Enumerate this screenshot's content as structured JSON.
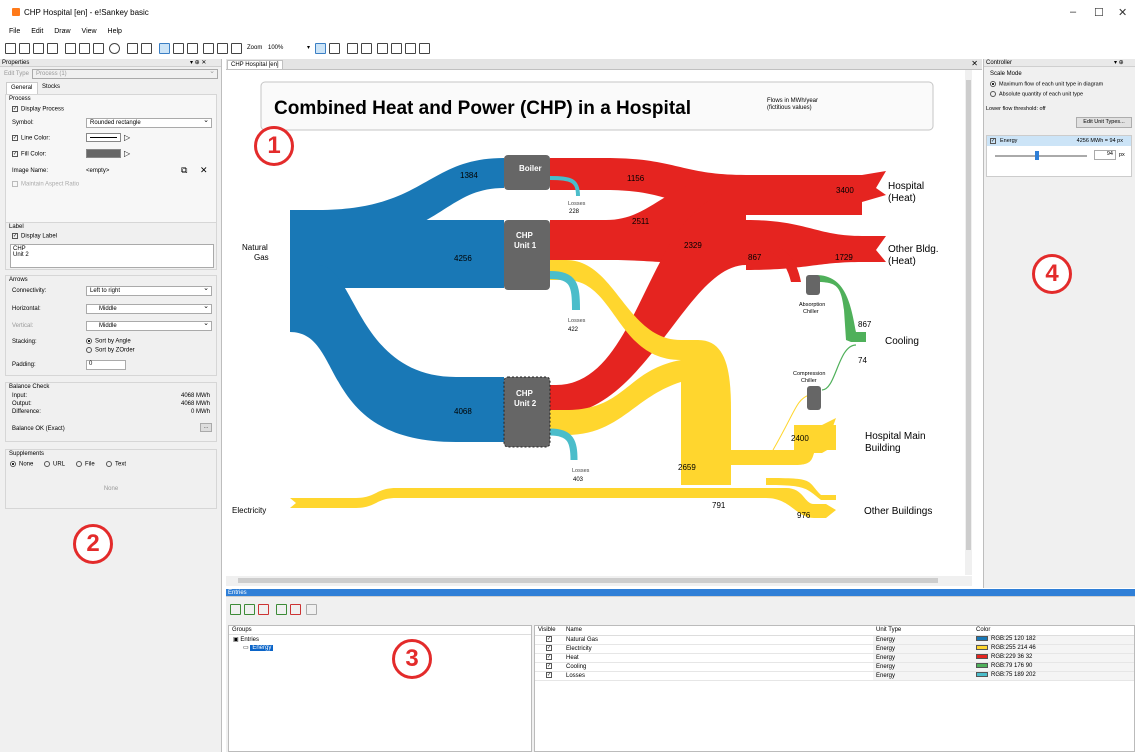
{
  "window": {
    "title": "CHP Hospital [en] - e!Sankey basic"
  },
  "menu": [
    "File",
    "Edit",
    "Draw",
    "View",
    "Help"
  ],
  "toolbar": {
    "zoom_label": "Zoom",
    "zoom_value": "100%"
  },
  "properties": {
    "panel_title": "Properties",
    "edit_type_label": "Edit Type",
    "edit_type_value": "Process (1)",
    "tabs": [
      "General",
      "Stocks"
    ],
    "process": {
      "header": "Process",
      "display_process": "Display Process",
      "symbol_label": "Symbol:",
      "symbol_value": "Rounded rectangle",
      "line_color_label": "Line Color:",
      "fill_color_label": "Fill Color:",
      "image_name_label": "Image Name:",
      "image_name_value": "<empty>",
      "maintain_aspect": "Maintain Aspect Ratio"
    },
    "label": {
      "header": "Label",
      "display_label": "Display Label",
      "line1": "CHP",
      "line2": "Unit 2"
    },
    "arrows": {
      "header": "Arrows",
      "connectivity_label": "Connectivity:",
      "connectivity_value": "Left to right",
      "horizontal_label": "Horizontal:",
      "horizontal_value": "Middle",
      "vertical_label": "Vertical:",
      "vertical_value": "Middle",
      "stacking_label": "Stacking:",
      "stacking_opt1": "Sort by Angle",
      "stacking_opt2": "Sort by ZOrder",
      "padding_label": "Padding:",
      "padding_value": "0"
    },
    "balance": {
      "header": "Balance Check",
      "input_label": "Input:",
      "input_value": "4068 MWh",
      "output_label": "Output:",
      "output_value": "4068 MWh",
      "difference_label": "Difference:",
      "difference_value": "0 MWh",
      "status": "Balance OK (Exact)"
    },
    "supplements": {
      "header": "Supplements",
      "options": [
        "None",
        "URL",
        "File",
        "Text"
      ],
      "current": "None"
    }
  },
  "document_tab": "CHP Hospital [en]",
  "diagram": {
    "title": "Combined Heat and Power (CHP) in a Hospital",
    "note1": "Flows in MWh/year",
    "note2": "(fictitious values)",
    "nodes": {
      "natural_gas1": "Natural",
      "natural_gas2": "Gas",
      "electricity": "Electricity",
      "boiler": "Boiler",
      "chp1a": "CHP",
      "chp1b": "Unit 1",
      "chp2a": "CHP",
      "chp2b": "Unit 2",
      "absorption1": "Absorption",
      "absorption2": "Chiller",
      "compression1": "Compression",
      "compression2": "Chiller",
      "hospital_heat1": "Hospital",
      "hospital_heat2": "(Heat)",
      "other_heat1": "Other Bldg.",
      "other_heat2": "(Heat)",
      "cooling": "Cooling",
      "hospital_main1": "Hospital Main",
      "hospital_main2": "Building",
      "other_buildings": "Other Buildings",
      "losses": "Losses"
    },
    "values": {
      "gas_boiler": "1384",
      "gas_chp1": "4256",
      "gas_chp2": "4068",
      "boiler_heat": "1156",
      "boiler_loss": "228",
      "chp1_heat": "2511",
      "chp1_loss": "422",
      "chp2_heat": "2329",
      "chp2_loss": "403",
      "hospital_heat": "3400",
      "other_heat": "1729",
      "to_absorption": "867",
      "cooling_in": "867",
      "compression": "74",
      "elec_junction": "2659",
      "hospital_main": "2400",
      "elec_direct": "791",
      "other_buildings": "976"
    }
  },
  "callouts": [
    "1",
    "2",
    "3",
    "4"
  ],
  "controller": {
    "title": "Controller",
    "scale_mode": "Scale Mode",
    "opt1": "Maximum flow of each unit type in diagram",
    "opt2": "Absolute quantity of each unit type",
    "threshold": "Lower flow threshold: off",
    "edit_button": "Edit Unit Types...",
    "energy_label": "Energy",
    "energy_scale": "4256 MWh = 94 px",
    "px_value": "94",
    "px_unit": "px",
    "slider_fraction": 0.45
  },
  "entries": {
    "title": "Entries",
    "groups_header": "Groups",
    "tree_root": "Entries",
    "tree_child": "Energy",
    "columns": [
      "Visible",
      "Name",
      "Unit Type",
      "Color"
    ],
    "rows": [
      {
        "name": "Natural Gas",
        "unit": "Energy",
        "color": "RGB:25 120 182",
        "hex": "#1978b6"
      },
      {
        "name": "Electricity",
        "unit": "Energy",
        "color": "RGB:255 214 46",
        "hex": "#ffd62e"
      },
      {
        "name": "Heat",
        "unit": "Energy",
        "color": "RGB:229 36 32",
        "hex": "#e52420"
      },
      {
        "name": "Cooling",
        "unit": "Energy",
        "color": "RGB:79 176 90",
        "hex": "#4fb05a"
      },
      {
        "name": "Losses",
        "unit": "Energy",
        "color": "RGB:75 189 202",
        "hex": "#4bbdca"
      }
    ]
  },
  "colors": {
    "gas": "#1978b6",
    "electricity": "#ffd62e",
    "heat": "#e52420",
    "cooling": "#4fb05a",
    "losses": "#4bbdca",
    "node": "#666666",
    "callout": "#e32b2b"
  }
}
